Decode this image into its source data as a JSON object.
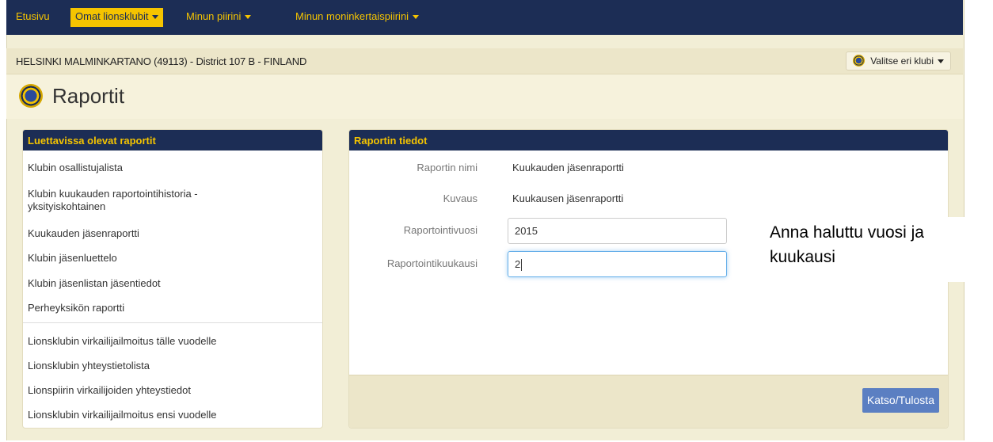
{
  "nav": {
    "items": [
      {
        "label": "Etusivu"
      },
      {
        "label": "Omat lionsklubit"
      },
      {
        "label": "Minun piirini"
      },
      {
        "label": "Minun moninkertaispiirini"
      }
    ]
  },
  "club": {
    "title": "HELSINKI MALMINKARTANO (49113) - District 107 B - FINLAND",
    "select_button": "Valitse eri klubi"
  },
  "page": {
    "title": "Raportit"
  },
  "reports_panel": {
    "heading": "Luettavissa olevat raportit",
    "group1": [
      "Klubin osallistujalista",
      "Klubin kuukauden raportointihistoria - yksityiskohtainen",
      "Kuukauden jäsenraportti",
      "Klubin jäsenluettelo",
      "Klubin jäsenlistan jäsentiedot",
      "Perheyksikön raportti"
    ],
    "group2": [
      "Lionsklubin virkailijailmoitus tälle vuodelle",
      "Lionsklubin yhteystietolista",
      "Lionspiirin virkailijoiden yhteystiedot",
      "Lionsklubin virkailijailmoitus ensi vuodelle"
    ]
  },
  "details_panel": {
    "heading": "Raportin tiedot",
    "name_label": "Raportin nimi",
    "name_value": "Kuukauden jäsenraportti",
    "desc_label": "Kuvaus",
    "desc_value": "Kuukausen jäsenraportti",
    "year_label": "Raportointivuosi",
    "year_value": "2015",
    "month_label": "Raportointikuukausi",
    "month_value": "2",
    "submit_label": "Katso/Tulosta"
  },
  "annotation": {
    "text_line1": "Anna haluttu vuosi ja",
    "text_line2": "kuukausi"
  },
  "colors": {
    "navy": "#1c2d55",
    "gold": "#f5c400",
    "primary_button": "#5b7fc2"
  }
}
